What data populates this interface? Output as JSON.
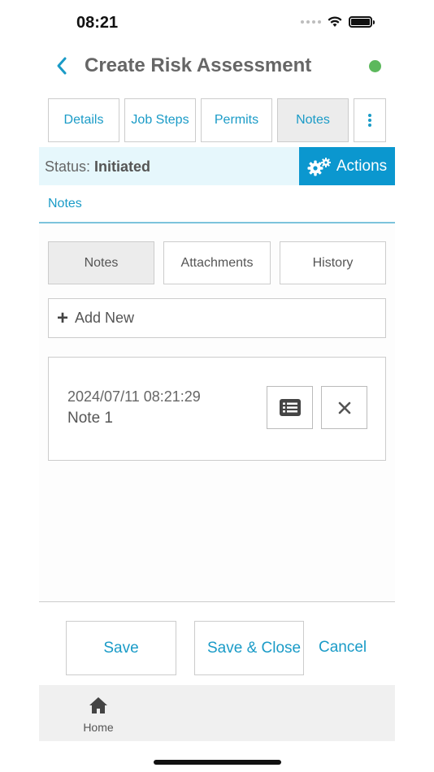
{
  "status_bar": {
    "time": "08:21"
  },
  "header": {
    "title": "Create Risk Assessment",
    "online_color": "#5cb85c"
  },
  "tabs": [
    {
      "label": "Details",
      "active": false
    },
    {
      "label": "Job Steps",
      "active": false
    },
    {
      "label": "Permits",
      "active": false
    },
    {
      "label": "Notes",
      "active": true
    }
  ],
  "status": {
    "prefix": "Status: ",
    "value": "Initiated",
    "actions_label": "Actions"
  },
  "section": {
    "label": "Notes"
  },
  "subtabs": [
    {
      "label": "Notes",
      "active": true
    },
    {
      "label": "Attachments",
      "active": false
    },
    {
      "label": "History",
      "active": false
    }
  ],
  "add_new": {
    "label": "Add New"
  },
  "notes": [
    {
      "date": "2024/07/11 08:21:29",
      "title": "Note 1"
    }
  ],
  "footer": {
    "save": "Save",
    "save_close": "Save & Close",
    "cancel": "Cancel"
  },
  "bottom_nav": {
    "home": "Home"
  },
  "colors": {
    "accent": "#1a9bc7",
    "actions_bg": "#0b97cf",
    "status_bg": "#e6f7fc"
  }
}
